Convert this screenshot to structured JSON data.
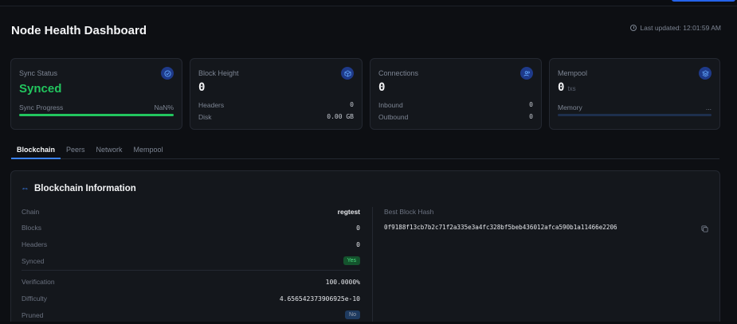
{
  "header": {
    "title": "Node Health Dashboard",
    "last_updated": "Last updated: 12:01:59 AM"
  },
  "cards": {
    "sync": {
      "label": "Sync Status",
      "value": "Synced",
      "progress_label": "Sync Progress",
      "progress_value": "NaN%"
    },
    "block": {
      "label": "Block Height",
      "value": "0",
      "headers_label": "Headers",
      "headers_value": "0",
      "disk_label": "Disk",
      "disk_value": "0.00 GB"
    },
    "connections": {
      "label": "Connections",
      "value": "0",
      "inbound_label": "Inbound",
      "inbound_value": "0",
      "outbound_label": "Outbound",
      "outbound_value": "0"
    },
    "mempool": {
      "label": "Mempool",
      "value": "0",
      "unit": "txs",
      "memory_label": "Memory",
      "memory_value": "..."
    }
  },
  "tabs": [
    "Blockchain",
    "Peers",
    "Network",
    "Mempool"
  ],
  "panel": {
    "title": "Blockchain Information",
    "rows": [
      {
        "label": "Chain",
        "value": "regtest"
      },
      {
        "label": "Blocks",
        "value": "0"
      },
      {
        "label": "Headers",
        "value": "0"
      },
      {
        "label": "Synced",
        "value": "Yes"
      },
      {
        "label": "Verification",
        "value": "100.0000%"
      },
      {
        "label": "Difficulty",
        "value": "4.656542373906925e-10"
      },
      {
        "label": "Pruned",
        "value": "No"
      }
    ],
    "hash_label": "Best Block Hash",
    "hash_value": "0f9188f13cb7b2c71f2a335e3a4fc328bf5beb436012afca590b1a11466e2206"
  },
  "colors": {
    "accent": "#3b82f6",
    "success": "#22c55e",
    "background": "#0d0f13",
    "card": "#14171c"
  }
}
